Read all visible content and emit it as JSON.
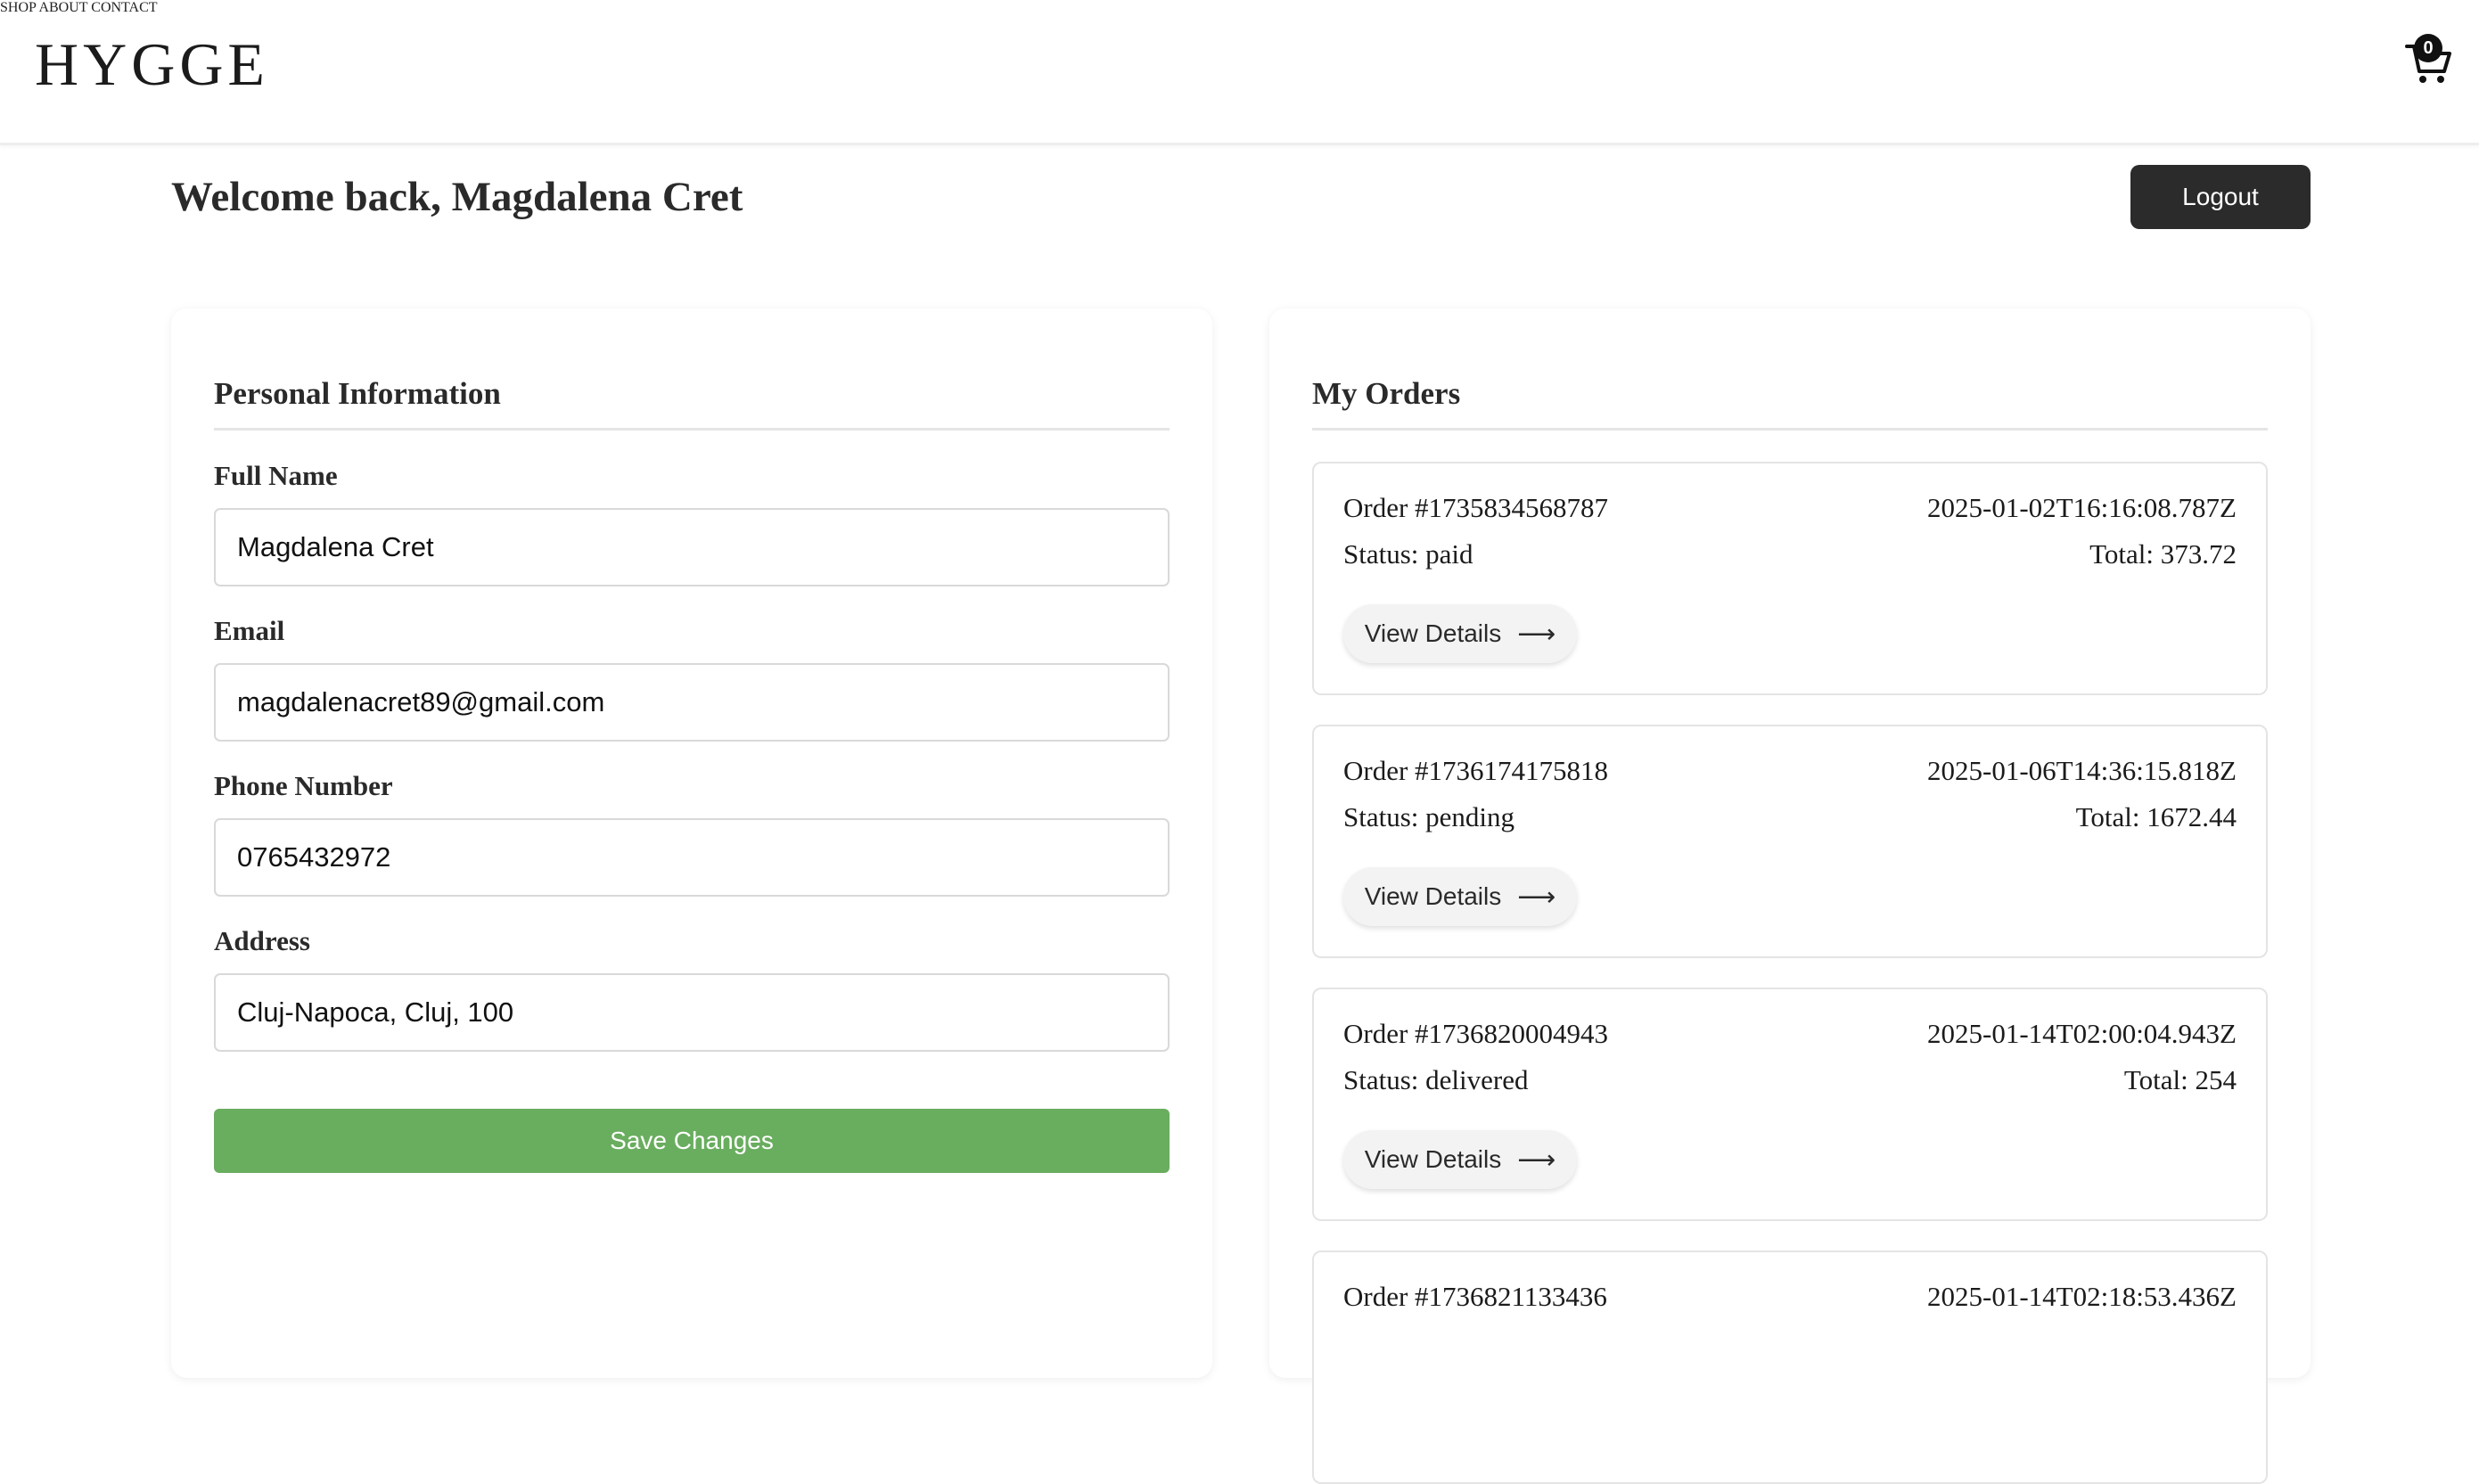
{
  "brand": {
    "logo": "HYGGE"
  },
  "nav": {
    "items": [
      "SHOP",
      "ABOUT",
      "CONTACT"
    ]
  },
  "cart": {
    "count": "0",
    "icon": "cart-icon"
  },
  "welcome": {
    "title": "Welcome back, Magdalena Cret",
    "logout_label": "Logout"
  },
  "personal": {
    "title": "Personal Information",
    "fields": [
      {
        "label": "Full Name",
        "value": "Magdalena Cret"
      },
      {
        "label": "Email",
        "value": "magdalenacret89@gmail.com"
      },
      {
        "label": "Phone Number",
        "value": "0765432972"
      },
      {
        "label": "Address",
        "value": "Cluj-Napoca, Cluj, 100"
      }
    ],
    "save_label": "Save Changes"
  },
  "orders": {
    "title": "My Orders",
    "view_label": "View Details",
    "arrow": "⟶",
    "items": [
      {
        "id": "Order #1735834568787",
        "date": "2025-01-02T16:16:08.787Z",
        "status": "Status: paid",
        "total": "Total: 373.72"
      },
      {
        "id": "Order #1736174175818",
        "date": "2025-01-06T14:36:15.818Z",
        "status": "Status: pending",
        "total": "Total: 1672.44"
      },
      {
        "id": "Order #1736820004943",
        "date": "2025-01-14T02:00:04.943Z",
        "status": "Status: delivered",
        "total": "Total: 254"
      },
      {
        "id": "Order #1736821133436",
        "date": "2025-01-14T02:18:53.436Z",
        "status": "",
        "total": ""
      }
    ]
  },
  "colors": {
    "save": "#69ad5e",
    "logout": "#2b2b2b",
    "badge": "#111111"
  }
}
